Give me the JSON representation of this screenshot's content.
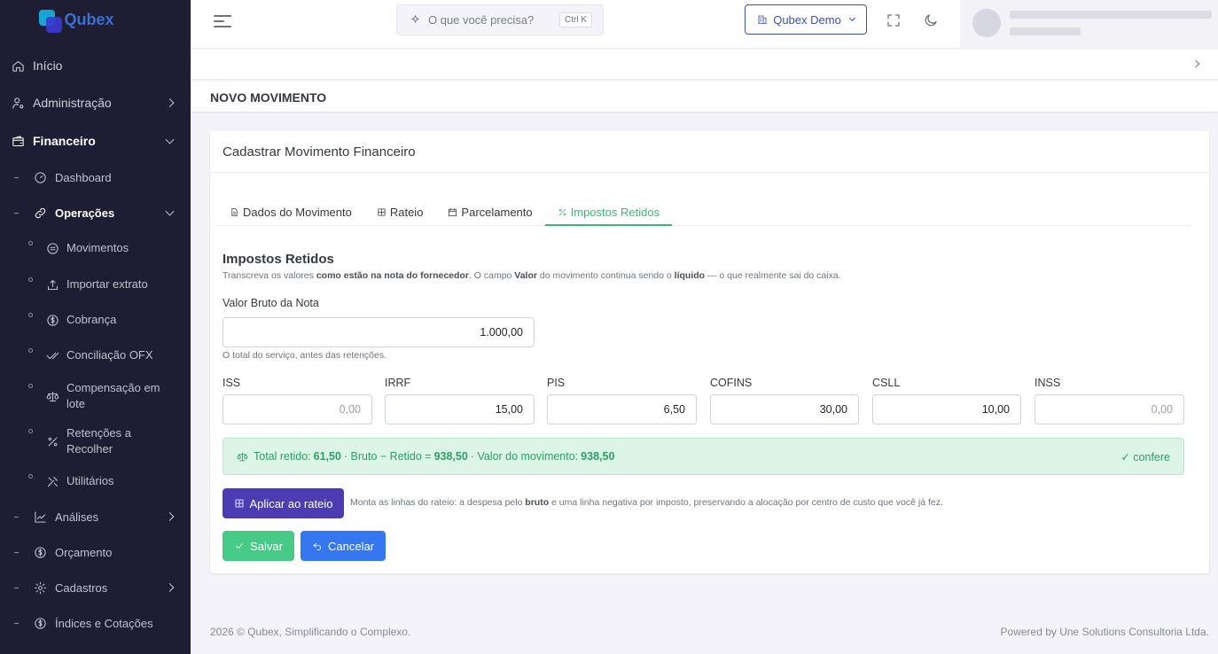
{
  "brand": {
    "name": "Qubex",
    "colors": {
      "sidebar_bg": "#1e1d33",
      "accent_green": "#45cb85",
      "accent_purple": "#4b3cb3",
      "accent_blue": "#3577f1"
    }
  },
  "sidebar": {
    "items": [
      {
        "label": "Início",
        "icon": "home-icon"
      },
      {
        "label": "Administração",
        "icon": "user-cog-icon"
      },
      {
        "label": "Financeiro",
        "icon": "wallet-icon"
      }
    ],
    "financeiro": {
      "dashboard": "Dashboard",
      "operacoes": "Operações",
      "operacoes_items": [
        {
          "label": "Movimentos",
          "icon": "coin-icon"
        },
        {
          "label": "Importar extrato",
          "icon": "upload-icon"
        },
        {
          "label": "Cobrança",
          "icon": "dollar-icon"
        },
        {
          "label": "Conciliação OFX",
          "icon": "double-check-icon"
        },
        {
          "label": "Compensação em lote",
          "icon": "scale-icon"
        },
        {
          "label": "Retenções a Recolher",
          "icon": "percent-icon"
        },
        {
          "label": "Utilitários",
          "icon": "tools-icon"
        }
      ],
      "analises": "Análises",
      "orcamento": "Orçamento",
      "cadastros": "Cadastros",
      "indices": "Índices e Cotações"
    }
  },
  "topbar": {
    "search_placeholder": "O que você precisa?",
    "search_shortcut": "Ctrl K",
    "company": "Qubex Demo"
  },
  "page": {
    "title": "NOVO MOVIMENTO"
  },
  "card": {
    "title": "Cadastrar Movimento Financeiro",
    "tabs": [
      {
        "label": "Dados do Movimento",
        "icon": "file-icon"
      },
      {
        "label": "Rateio",
        "icon": "grid-icon"
      },
      {
        "label": "Parcelamento",
        "icon": "calendar-icon"
      },
      {
        "label": "Impostos Retidos",
        "icon": "percent-icon"
      }
    ],
    "active_tab": 3
  },
  "impostos": {
    "title": "Impostos Retidos",
    "desc_1": "Transcreva os valores ",
    "desc_b1": "como estão na nota do fornecedor",
    "desc_2": ". O campo ",
    "desc_b2": "Valor",
    "desc_3": " do movimento continua sendo o ",
    "desc_b3": "líquido",
    "desc_4": " — o que realmente sai do caixa.",
    "bruto_label": "Valor Bruto da Nota",
    "bruto_value": "1.000,00",
    "bruto_help": "O total do serviço, antes das retenções.",
    "fields": [
      {
        "label": "ISS",
        "value": "",
        "placeholder": "0,00"
      },
      {
        "label": "IRRF",
        "value": "15,00",
        "placeholder": "0,00"
      },
      {
        "label": "PIS",
        "value": "6,50",
        "placeholder": "0,00"
      },
      {
        "label": "COFINS",
        "value": "30,00",
        "placeholder": "0,00"
      },
      {
        "label": "CSLL",
        "value": "10,00",
        "placeholder": "0,00"
      },
      {
        "label": "INSS",
        "value": "",
        "placeholder": "0,00"
      }
    ],
    "summary": {
      "t1": "Total retido:",
      "total": "61,50",
      "t2": "· Bruto − Retido =",
      "liquido": "938,50",
      "t3": "· Valor do movimento:",
      "movimento": "938,50",
      "status": "✓ confere"
    },
    "apply_label": "Aplicar ao rateio",
    "apply_help_1": "Monta as linhas do rateio: a despesa pelo ",
    "apply_help_b": "bruto",
    "apply_help_2": " e uma linha negativa por imposto, preservando a alocação por centro de custo que você já fez.",
    "save_label": "Salvar",
    "cancel_label": "Cancelar"
  },
  "footer": {
    "left": "2026 © Qubex, Simplificando o Complexo.",
    "right": "Powered by Une Solutions Consultoria Ltda."
  }
}
